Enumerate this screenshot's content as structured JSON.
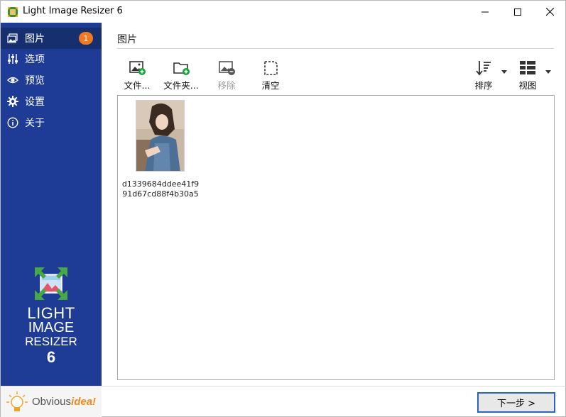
{
  "window": {
    "title": "Light Image Resizer 6"
  },
  "sidebar": {
    "items": [
      {
        "label": "图片",
        "icon": "images-icon",
        "badge": "1",
        "active": true
      },
      {
        "label": "选项",
        "icon": "sliders-icon"
      },
      {
        "label": "预览",
        "icon": "eye-icon"
      },
      {
        "label": "设置",
        "icon": "gear-icon"
      },
      {
        "label": "关于",
        "icon": "info-icon"
      }
    ],
    "logo": {
      "line1": "LIGHT",
      "line2": "IMAGE",
      "line3": "RESIZER",
      "line4": "6"
    },
    "brand": {
      "part1": "Obvious",
      "part2": "idea!"
    }
  },
  "main": {
    "page_title": "图片",
    "toolbar": {
      "add_files": "文件...",
      "add_folder": "文件夹...",
      "remove": "移除",
      "clear": "清空",
      "sort": "排序",
      "view": "视图"
    },
    "files": [
      {
        "name": "d1339684ddee41f991d67cd88f4b30a5"
      }
    ],
    "next_button": "下一步 >"
  },
  "colors": {
    "sidebar_bg": "#1e3c96",
    "sidebar_active": "#16306f",
    "badge": "#f07a22",
    "add_green": "#1aa33a",
    "primary_border": "#2b63c7"
  }
}
